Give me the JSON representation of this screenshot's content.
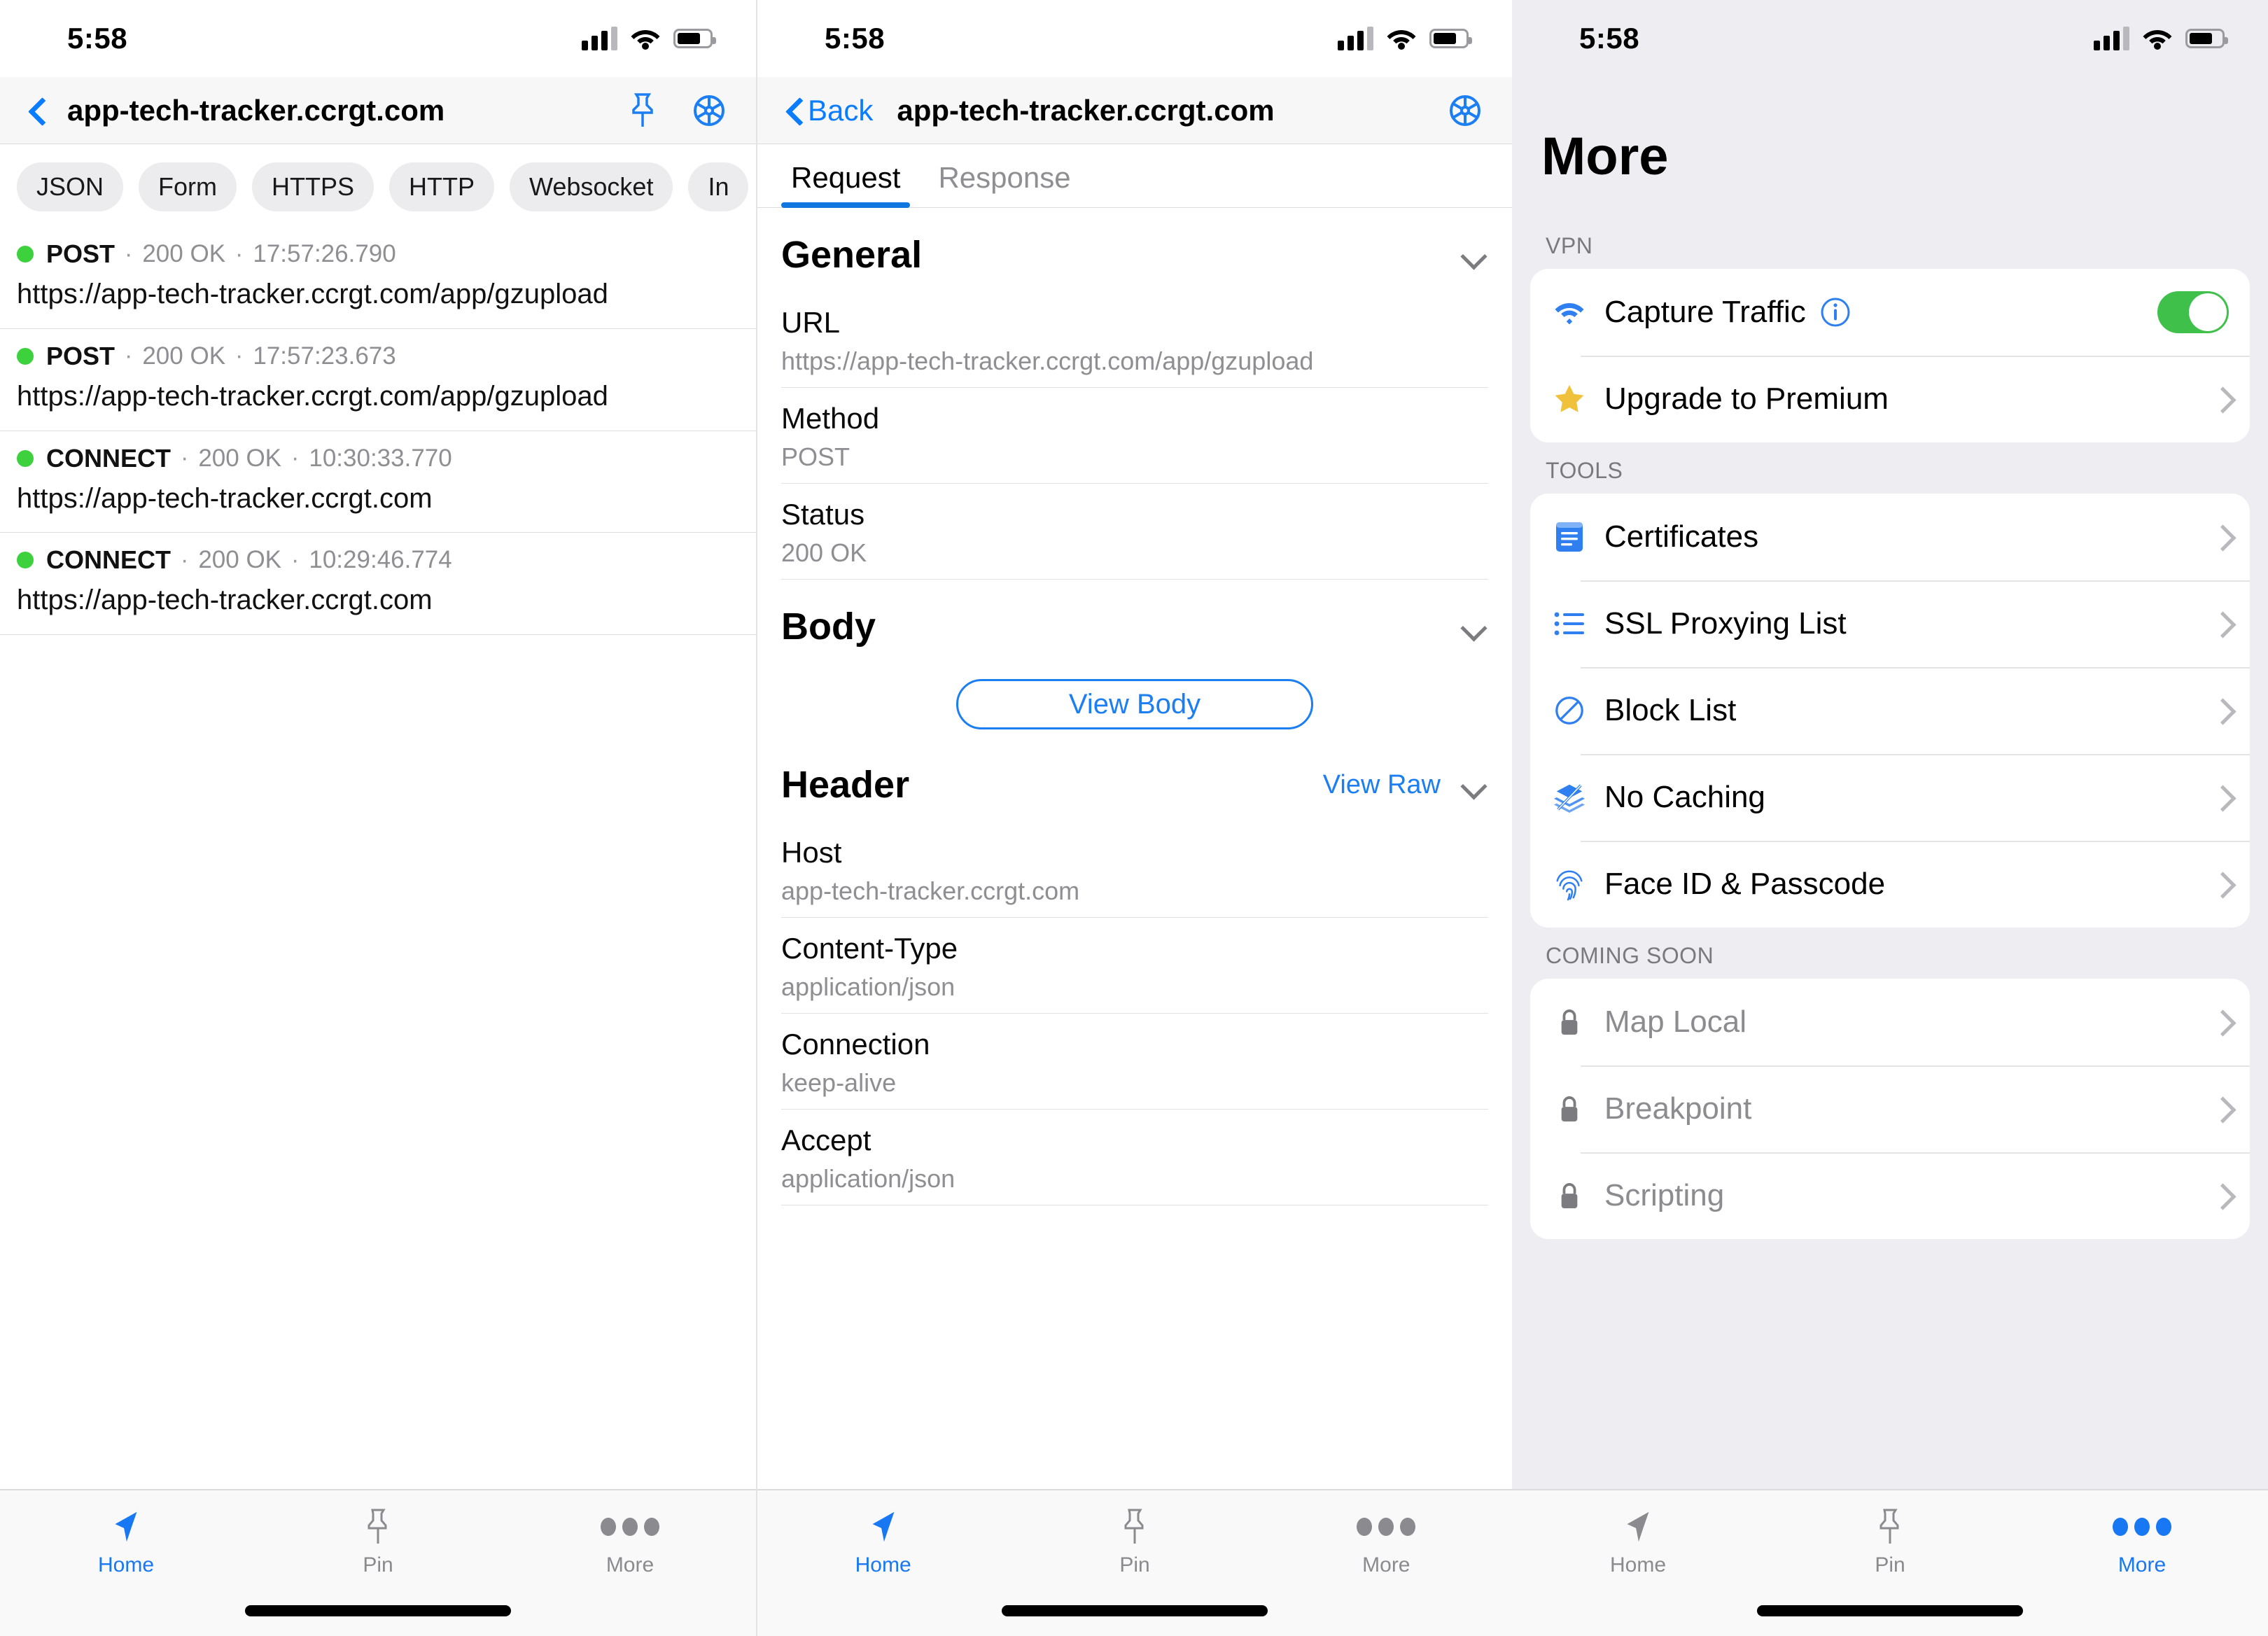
{
  "statusbar": {
    "time": "5:58"
  },
  "screen1": {
    "nav": {
      "title": "app-tech-tracker.ccrgt.com"
    },
    "chips": [
      "JSON",
      "Form",
      "HTTPS",
      "HTTP",
      "Websocket",
      "In"
    ],
    "requests": [
      {
        "method": "POST",
        "status": "200 OK",
        "time": "17:57:26.790",
        "url": "https://app-tech-tracker.ccrgt.com/app/gzupload"
      },
      {
        "method": "POST",
        "status": "200 OK",
        "time": "17:57:23.673",
        "url": "https://app-tech-tracker.ccrgt.com/app/gzupload"
      },
      {
        "method": "CONNECT",
        "status": "200 OK",
        "time": "10:30:33.770",
        "url": "https://app-tech-tracker.ccrgt.com"
      },
      {
        "method": "CONNECT",
        "status": "200 OK",
        "time": "10:29:46.774",
        "url": "https://app-tech-tracker.ccrgt.com"
      }
    ],
    "separator": "·",
    "tabbar": [
      {
        "label": "Home",
        "icon": "paper-plane-icon",
        "active": true
      },
      {
        "label": "Pin",
        "icon": "pin-icon",
        "active": false
      },
      {
        "label": "More",
        "icon": "ellipsis-icon",
        "active": false
      }
    ]
  },
  "screen2": {
    "nav": {
      "back_label": "Back",
      "title": "app-tech-tracker.ccrgt.com"
    },
    "tabs": [
      {
        "label": "Request",
        "active": true
      },
      {
        "label": "Response",
        "active": false
      }
    ],
    "general": {
      "title": "General",
      "rows": [
        {
          "key": "URL",
          "value": "https://app-tech-tracker.ccrgt.com/app/gzupload"
        },
        {
          "key": "Method",
          "value": "POST"
        },
        {
          "key": "Status",
          "value": "200 OK"
        }
      ]
    },
    "body": {
      "title": "Body",
      "button": "View Body"
    },
    "header": {
      "title": "Header",
      "view_raw": "View Raw",
      "rows": [
        {
          "key": "Host",
          "value": "app-tech-tracker.ccrgt.com"
        },
        {
          "key": "Content-Type",
          "value": "application/json"
        },
        {
          "key": "Connection",
          "value": "keep-alive"
        },
        {
          "key": "Accept",
          "value": "application/json"
        }
      ]
    },
    "tabbar": [
      {
        "label": "Home",
        "icon": "paper-plane-icon",
        "active": true
      },
      {
        "label": "Pin",
        "icon": "pin-icon",
        "active": false
      },
      {
        "label": "More",
        "icon": "ellipsis-icon",
        "active": false
      }
    ]
  },
  "screen3": {
    "title": "More",
    "groups": [
      {
        "label": "VPN",
        "rows": [
          {
            "label": "Capture Traffic",
            "icon": "wifi-icon",
            "control": "toggle",
            "toggle_on": true,
            "has_info": true,
            "disabled": false
          },
          {
            "label": "Upgrade to Premium",
            "icon": "star-icon",
            "control": "chevron",
            "disabled": false
          }
        ]
      },
      {
        "label": "TOOLS",
        "rows": [
          {
            "label": "Certificates",
            "icon": "certificate-icon",
            "control": "chevron",
            "disabled": false
          },
          {
            "label": "SSL Proxying List",
            "icon": "list-icon",
            "control": "chevron",
            "disabled": false
          },
          {
            "label": "Block List",
            "icon": "block-icon",
            "control": "chevron",
            "disabled": false
          },
          {
            "label": "No Caching",
            "icon": "no-caching-icon",
            "control": "chevron",
            "disabled": false
          },
          {
            "label": "Face ID & Passcode",
            "icon": "fingerprint-icon",
            "control": "chevron",
            "disabled": false
          }
        ]
      },
      {
        "label": "COMING SOON",
        "rows": [
          {
            "label": "Map Local",
            "icon": "lock-icon",
            "control": "chevron",
            "disabled": true
          },
          {
            "label": "Breakpoint",
            "icon": "lock-icon",
            "control": "chevron",
            "disabled": true
          },
          {
            "label": "Scripting",
            "icon": "lock-icon",
            "control": "chevron",
            "disabled": true
          }
        ]
      }
    ],
    "tabbar": [
      {
        "label": "Home",
        "icon": "paper-plane-icon",
        "active": false
      },
      {
        "label": "Pin",
        "icon": "pin-icon",
        "active": false
      },
      {
        "label": "More",
        "icon": "ellipsis-icon",
        "active": true
      }
    ]
  },
  "colors": {
    "accent_blue": "#1b7ef2",
    "status_green": "#3dd13d",
    "toggle_green": "#3fc04a",
    "star_yellow": "#f2c230",
    "muted_gray": "#8e8e93"
  }
}
